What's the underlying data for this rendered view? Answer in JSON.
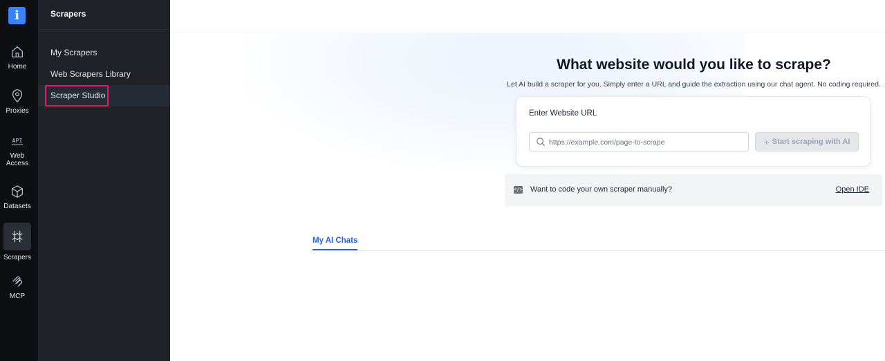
{
  "rail": {
    "logo": "i",
    "items": [
      {
        "label": "Home",
        "icon": "home-icon"
      },
      {
        "label": "Proxies",
        "icon": "location-pin-icon"
      },
      {
        "label": "Web\nAccess",
        "label_line1": "Web",
        "label_line2": "Access",
        "icon": "api-icon"
      },
      {
        "label": "Datasets",
        "icon": "cube-icon"
      },
      {
        "label": "Scrapers",
        "icon": "scrapers-icon",
        "active": true
      },
      {
        "label": "MCP",
        "icon": "mcp-icon"
      }
    ]
  },
  "subnav": {
    "title": "Scrapers",
    "items": [
      {
        "label": "My Scrapers"
      },
      {
        "label": "Web Scrapers Library"
      },
      {
        "label": "Scraper Studio",
        "active": true
      }
    ]
  },
  "main": {
    "heading": "What website would you like to scrape?",
    "subheading": "Let AI build a scraper for you. Simply enter a URL and guide the extraction using our chat agent. No coding required.",
    "card": {
      "label": "Enter Website URL",
      "input_value": "",
      "input_placeholder": "https://example.com/page-to-scrape",
      "button_label": "Start scraping with AI"
    },
    "ide": {
      "text": "Want to code your own scraper manually?",
      "link": "Open IDE"
    },
    "tabs": [
      {
        "label": "My AI Chats",
        "active": true
      }
    ]
  },
  "colors": {
    "rail_bg": "#0d0f12",
    "subnav_bg": "#1f2226",
    "accent": "#2563eb",
    "logo": "#3b82f6",
    "highlight": "#e11d6a"
  }
}
